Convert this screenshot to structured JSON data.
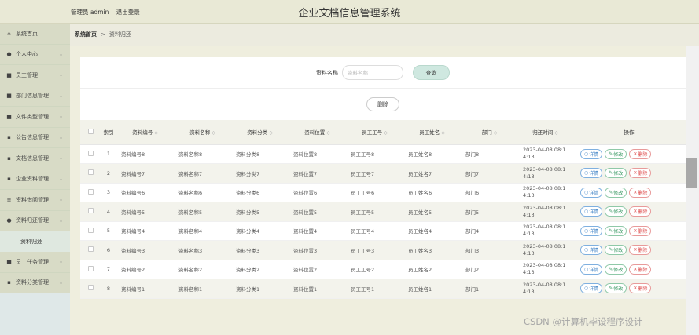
{
  "header": {
    "admin_label": "管理员 admin",
    "logout_label": "退出登录",
    "app_title": "企业文档信息管理系统"
  },
  "sidebar": {
    "items": [
      {
        "label": "系统首页",
        "icon": "home-icon",
        "glyph": "⌂"
      },
      {
        "label": "个人中心",
        "icon": "user-icon",
        "glyph": "●"
      },
      {
        "label": "员工管理",
        "icon": "briefcase-icon",
        "glyph": "■"
      },
      {
        "label": "部门信息管理",
        "icon": "folder-icon",
        "glyph": "■"
      },
      {
        "label": "文件类型管理",
        "icon": "file-type-icon",
        "glyph": "■"
      },
      {
        "label": "公告信息管理",
        "icon": "grid-icon",
        "glyph": "▪"
      },
      {
        "label": "文档信息管理",
        "icon": "grid-icon",
        "glyph": "▪"
      },
      {
        "label": "企业资料管理",
        "icon": "grid-icon",
        "glyph": "▪"
      },
      {
        "label": "资料借阅管理",
        "icon": "list-icon",
        "glyph": "≡"
      },
      {
        "label": "资料归还管理",
        "icon": "user-icon",
        "glyph": "●"
      },
      {
        "label": "员工任务管理",
        "icon": "task-icon",
        "glyph": "■"
      },
      {
        "label": "资料分类管理",
        "icon": "grid-icon",
        "glyph": "▪"
      }
    ],
    "sub_item": "资料归还"
  },
  "breadcrumb": {
    "home": "系统首页",
    "separator": ">",
    "current": "资料归还"
  },
  "search": {
    "label": "资料名称",
    "placeholder": "资料名称",
    "button": "查询"
  },
  "actions": {
    "delete_label": "删除"
  },
  "table": {
    "headers": [
      "索引",
      "资料编号",
      "资料名称",
      "资料分类",
      "资料位置",
      "员工工号",
      "员工姓名",
      "部门",
      "归还时间",
      "操作"
    ],
    "sort_mark": "◇",
    "rows": [
      {
        "idx": "1",
        "code": "资料编号8",
        "name": "资料名称8",
        "cat": "资料分类8",
        "loc": "资料位置8",
        "emp_no": "员工工号8",
        "emp_name": "员工姓名8",
        "dept": "部门8",
        "time": "2023-04-08 08:1\n4:13"
      },
      {
        "idx": "2",
        "code": "资料编号7",
        "name": "资料名称7",
        "cat": "资料分类7",
        "loc": "资料位置7",
        "emp_no": "员工工号7",
        "emp_name": "员工姓名7",
        "dept": "部门7",
        "time": "2023-04-08 08:1\n4:13"
      },
      {
        "idx": "3",
        "code": "资料编号6",
        "name": "资料名称6",
        "cat": "资料分类6",
        "loc": "资料位置6",
        "emp_no": "员工工号6",
        "emp_name": "员工姓名6",
        "dept": "部门6",
        "time": "2023-04-08 08:1\n4:13"
      },
      {
        "idx": "4",
        "code": "资料编号5",
        "name": "资料名称5",
        "cat": "资料分类5",
        "loc": "资料位置5",
        "emp_no": "员工工号5",
        "emp_name": "员工姓名5",
        "dept": "部门5",
        "time": "2023-04-08 08:1\n4:13"
      },
      {
        "idx": "5",
        "code": "资料编号4",
        "name": "资料名称4",
        "cat": "资料分类4",
        "loc": "资料位置4",
        "emp_no": "员工工号4",
        "emp_name": "员工姓名4",
        "dept": "部门4",
        "time": "2023-04-08 08:1\n4:13"
      },
      {
        "idx": "6",
        "code": "资料编号3",
        "name": "资料名称3",
        "cat": "资料分类3",
        "loc": "资料位置3",
        "emp_no": "员工工号3",
        "emp_name": "员工姓名3",
        "dept": "部门3",
        "time": "2023-04-08 08:1\n4:13"
      },
      {
        "idx": "7",
        "code": "资料编号2",
        "name": "资料名称2",
        "cat": "资料分类2",
        "loc": "资料位置2",
        "emp_no": "员工工号2",
        "emp_name": "员工姓名2",
        "dept": "部门2",
        "time": "2023-04-08 08:1\n4:13"
      },
      {
        "idx": "8",
        "code": "资料编号1",
        "name": "资料名称1",
        "cat": "资料分类1",
        "loc": "资料位置1",
        "emp_no": "员工工号1",
        "emp_name": "员工姓名1",
        "dept": "部门1",
        "time": "2023-04-08 08:1\n4:13"
      }
    ],
    "ops": {
      "detail": "详情",
      "edit": "修改",
      "delete": "删除"
    }
  },
  "watermark": "CSDN @计算机毕设程序设计",
  "colors": {
    "header_bg": "#e9e9d6",
    "sidebar_bg": "#d8dbc6",
    "content_bg": "#efeede",
    "search_button_bg": "#cfe8e0",
    "detail_accent": "#3a7fc4",
    "edit_accent": "#3a9a64",
    "delete_accent": "#dd4444"
  }
}
